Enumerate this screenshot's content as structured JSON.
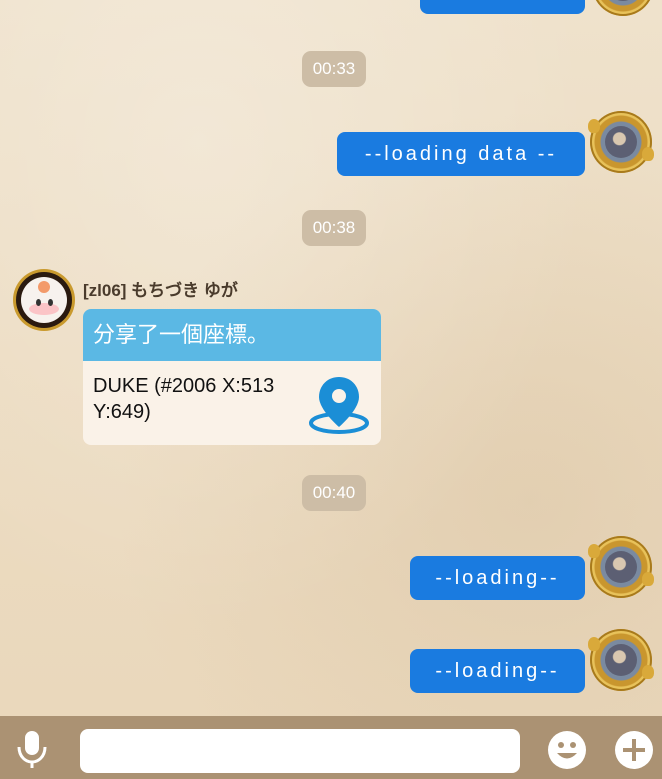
{
  "conversation": {
    "timestamps": [
      "00:33",
      "00:38",
      "00:40"
    ],
    "outgoing_messages": [
      "--loading data --",
      "--loading--",
      "--loading--"
    ],
    "incoming": {
      "sender_name": "[zl06] もちづき ゆが",
      "share_title": "分享了一個座標。",
      "share_location": "DUKE (#2006 X:513 Y:649)"
    }
  },
  "input_bar": {
    "placeholder": "",
    "mic_icon": "microphone-icon",
    "emoji_icon": "smiley-icon",
    "add_icon": "plus-icon"
  },
  "colors": {
    "outgoing_bubble": "#1a7be0",
    "share_header": "#5bb8e4",
    "timestamp_badge": "#cdbda6",
    "input_bar": "#ab9273",
    "pin": "#1b8ed6"
  }
}
